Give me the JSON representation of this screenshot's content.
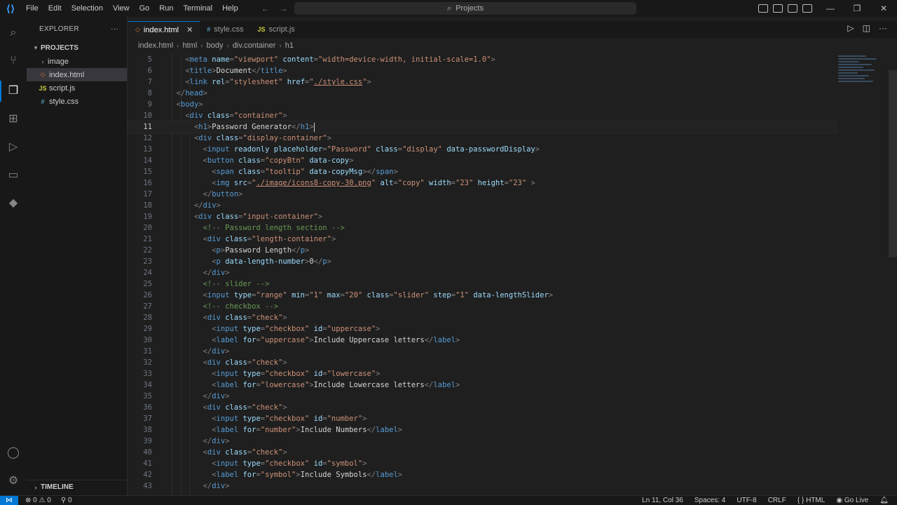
{
  "menu": [
    "File",
    "Edit",
    "Selection",
    "View",
    "Go",
    "Run",
    "Terminal",
    "Help"
  ],
  "command_center": {
    "icon": "search-icon",
    "label": "Projects"
  },
  "sidebar": {
    "title": "EXPLORER",
    "more": "···",
    "section": "PROJECTS",
    "items": [
      {
        "label": "image",
        "type": "folder"
      },
      {
        "label": "index.html",
        "type": "html",
        "selected": true
      },
      {
        "label": "script.js",
        "type": "js"
      },
      {
        "label": "style.css",
        "type": "css"
      }
    ],
    "timeline": "TIMELINE"
  },
  "tabs": [
    {
      "label": "index.html",
      "type": "html",
      "active": true
    },
    {
      "label": "style.css",
      "type": "css"
    },
    {
      "label": "script.js",
      "type": "js"
    }
  ],
  "breadcrumb": [
    "index.html",
    "html",
    "body",
    "div.container",
    "h1"
  ],
  "code_lines": [
    {
      "n": "5",
      "t": [
        [
          "    ",
          ""
        ],
        [
          "<",
          "p"
        ],
        [
          "meta",
          "g"
        ],
        [
          " name",
          "a"
        ],
        [
          "=",
          "p"
        ],
        [
          "\"viewport\"",
          "v"
        ],
        [
          " content",
          "a"
        ],
        [
          "=",
          "p"
        ],
        [
          "\"width=device-width, initial-scale=1.0\"",
          "v"
        ],
        [
          ">",
          "p"
        ]
      ]
    },
    {
      "n": "6",
      "t": [
        [
          "    ",
          ""
        ],
        [
          "<",
          "p"
        ],
        [
          "title",
          "g"
        ],
        [
          ">",
          "p"
        ],
        [
          "Document",
          "x"
        ],
        [
          "</",
          "p"
        ],
        [
          "title",
          "g"
        ],
        [
          ">",
          "p"
        ]
      ]
    },
    {
      "n": "7",
      "t": [
        [
          "    ",
          ""
        ],
        [
          "<",
          "p"
        ],
        [
          "link",
          "g"
        ],
        [
          " rel",
          "a"
        ],
        [
          "=",
          "p"
        ],
        [
          "\"stylesheet\"",
          "v"
        ],
        [
          " href",
          "a"
        ],
        [
          "=",
          "p"
        ],
        [
          "\"",
          "v"
        ],
        [
          "./style.css",
          "u"
        ],
        [
          "\"",
          "v"
        ],
        [
          ">",
          "p"
        ]
      ]
    },
    {
      "n": "8",
      "t": [
        [
          "  ",
          ""
        ],
        [
          "</",
          "p"
        ],
        [
          "head",
          "g"
        ],
        [
          ">",
          "p"
        ]
      ]
    },
    {
      "n": "9",
      "t": [
        [
          "  ",
          ""
        ],
        [
          "<",
          "p"
        ],
        [
          "body",
          "g"
        ],
        [
          ">",
          "p"
        ]
      ]
    },
    {
      "n": "10",
      "t": [
        [
          "    ",
          ""
        ],
        [
          "<",
          "p"
        ],
        [
          "div",
          "g"
        ],
        [
          " class",
          "a"
        ],
        [
          "=",
          "p"
        ],
        [
          "\"container\"",
          "v"
        ],
        [
          ">",
          "p"
        ]
      ]
    },
    {
      "n": "11",
      "t": [
        [
          "      ",
          ""
        ],
        [
          "<",
          "p"
        ],
        [
          "h1",
          "g"
        ],
        [
          ">",
          "p"
        ],
        [
          "Password Generator",
          "x"
        ],
        [
          "</",
          "p"
        ],
        [
          "h1",
          "g"
        ],
        [
          ">",
          "p"
        ]
      ],
      "current": true
    },
    {
      "n": "12",
      "t": [
        [
          "      ",
          ""
        ],
        [
          "<",
          "p"
        ],
        [
          "div",
          "g"
        ],
        [
          " class",
          "a"
        ],
        [
          "=",
          "p"
        ],
        [
          "\"display-container\"",
          "v"
        ],
        [
          ">",
          "p"
        ]
      ]
    },
    {
      "n": "13",
      "t": [
        [
          "        ",
          ""
        ],
        [
          "<",
          "p"
        ],
        [
          "input",
          "g"
        ],
        [
          " readonly placeholder",
          "a"
        ],
        [
          "=",
          "p"
        ],
        [
          "\"Password\"",
          "v"
        ],
        [
          " class",
          "a"
        ],
        [
          "=",
          "p"
        ],
        [
          "\"display\"",
          "v"
        ],
        [
          " data-passwordDisplay",
          "a"
        ],
        [
          ">",
          "p"
        ]
      ]
    },
    {
      "n": "14",
      "t": [
        [
          "        ",
          ""
        ],
        [
          "<",
          "p"
        ],
        [
          "button",
          "g"
        ],
        [
          " class",
          "a"
        ],
        [
          "=",
          "p"
        ],
        [
          "\"copyBtn\"",
          "v"
        ],
        [
          " data-copy",
          "a"
        ],
        [
          ">",
          "p"
        ]
      ]
    },
    {
      "n": "15",
      "t": [
        [
          "          ",
          ""
        ],
        [
          "<",
          "p"
        ],
        [
          "span",
          "g"
        ],
        [
          " class",
          "a"
        ],
        [
          "=",
          "p"
        ],
        [
          "\"tooltip\"",
          "v"
        ],
        [
          " data-copyMsg",
          "a"
        ],
        [
          ">",
          "p"
        ],
        [
          "</",
          "p"
        ],
        [
          "span",
          "g"
        ],
        [
          ">",
          "p"
        ]
      ]
    },
    {
      "n": "16",
      "t": [
        [
          "          ",
          ""
        ],
        [
          "<",
          "p"
        ],
        [
          "img",
          "g"
        ],
        [
          " src",
          "a"
        ],
        [
          "=",
          "p"
        ],
        [
          "\"",
          "v"
        ],
        [
          "./image/icons8-copy-30.png",
          "u"
        ],
        [
          "\"",
          "v"
        ],
        [
          " alt",
          "a"
        ],
        [
          "=",
          "p"
        ],
        [
          "\"copy\"",
          "v"
        ],
        [
          " width",
          "a"
        ],
        [
          "=",
          "p"
        ],
        [
          "\"23\"",
          "v"
        ],
        [
          " height",
          "a"
        ],
        [
          "=",
          "p"
        ],
        [
          "\"23\"",
          "v"
        ],
        [
          " >",
          "p"
        ]
      ]
    },
    {
      "n": "17",
      "t": [
        [
          "        ",
          ""
        ],
        [
          "</",
          "p"
        ],
        [
          "button",
          "g"
        ],
        [
          ">",
          "p"
        ]
      ]
    },
    {
      "n": "18",
      "t": [
        [
          "      ",
          ""
        ],
        [
          "</",
          "p"
        ],
        [
          "div",
          "g"
        ],
        [
          ">",
          "p"
        ]
      ]
    },
    {
      "n": "19",
      "t": [
        [
          "      ",
          ""
        ],
        [
          "<",
          "p"
        ],
        [
          "div",
          "g"
        ],
        [
          " class",
          "a"
        ],
        [
          "=",
          "p"
        ],
        [
          "\"input-container\"",
          "v"
        ],
        [
          ">",
          "p"
        ]
      ]
    },
    {
      "n": "20",
      "t": [
        [
          "        ",
          ""
        ],
        [
          "<!-- Password length section -->",
          "c"
        ]
      ]
    },
    {
      "n": "21",
      "t": [
        [
          "        ",
          ""
        ],
        [
          "<",
          "p"
        ],
        [
          "div",
          "g"
        ],
        [
          " class",
          "a"
        ],
        [
          "=",
          "p"
        ],
        [
          "\"length-container\"",
          "v"
        ],
        [
          ">",
          "p"
        ]
      ]
    },
    {
      "n": "22",
      "t": [
        [
          "          ",
          ""
        ],
        [
          "<",
          "p"
        ],
        [
          "p",
          "g"
        ],
        [
          ">",
          "p"
        ],
        [
          "Password Length",
          "x"
        ],
        [
          "</",
          "p"
        ],
        [
          "p",
          "g"
        ],
        [
          ">",
          "p"
        ]
      ]
    },
    {
      "n": "23",
      "t": [
        [
          "          ",
          ""
        ],
        [
          "<",
          "p"
        ],
        [
          "p",
          "g"
        ],
        [
          " data-length-number",
          "a"
        ],
        [
          ">",
          "p"
        ],
        [
          "0",
          "x"
        ],
        [
          "</",
          "p"
        ],
        [
          "p",
          "g"
        ],
        [
          ">",
          "p"
        ]
      ]
    },
    {
      "n": "24",
      "t": [
        [
          "        ",
          ""
        ],
        [
          "</",
          "p"
        ],
        [
          "div",
          "g"
        ],
        [
          ">",
          "p"
        ]
      ]
    },
    {
      "n": "25",
      "t": [
        [
          "        ",
          ""
        ],
        [
          "<!-- slider -->",
          "c"
        ]
      ]
    },
    {
      "n": "26",
      "t": [
        [
          "        ",
          ""
        ],
        [
          "<",
          "p"
        ],
        [
          "input",
          "g"
        ],
        [
          " type",
          "a"
        ],
        [
          "=",
          "p"
        ],
        [
          "\"range\"",
          "v"
        ],
        [
          " min",
          "a"
        ],
        [
          "=",
          "p"
        ],
        [
          "\"1\"",
          "v"
        ],
        [
          " max",
          "a"
        ],
        [
          "=",
          "p"
        ],
        [
          "\"20\"",
          "v"
        ],
        [
          " class",
          "a"
        ],
        [
          "=",
          "p"
        ],
        [
          "\"slider\"",
          "v"
        ],
        [
          " step",
          "a"
        ],
        [
          "=",
          "p"
        ],
        [
          "\"1\"",
          "v"
        ],
        [
          " data-lengthSlider",
          "a"
        ],
        [
          ">",
          "p"
        ]
      ]
    },
    {
      "n": "27",
      "t": [
        [
          "        ",
          ""
        ],
        [
          "<!-- checkbox -->",
          "c"
        ]
      ]
    },
    {
      "n": "28",
      "t": [
        [
          "        ",
          ""
        ],
        [
          "<",
          "p"
        ],
        [
          "div",
          "g"
        ],
        [
          " class",
          "a"
        ],
        [
          "=",
          "p"
        ],
        [
          "\"check\"",
          "v"
        ],
        [
          ">",
          "p"
        ]
      ]
    },
    {
      "n": "29",
      "t": [
        [
          "          ",
          ""
        ],
        [
          "<",
          "p"
        ],
        [
          "input",
          "g"
        ],
        [
          " type",
          "a"
        ],
        [
          "=",
          "p"
        ],
        [
          "\"checkbox\"",
          "v"
        ],
        [
          " id",
          "a"
        ],
        [
          "=",
          "p"
        ],
        [
          "\"uppercase\"",
          "v"
        ],
        [
          ">",
          "p"
        ]
      ]
    },
    {
      "n": "30",
      "t": [
        [
          "          ",
          ""
        ],
        [
          "<",
          "p"
        ],
        [
          "label",
          "g"
        ],
        [
          " for",
          "a"
        ],
        [
          "=",
          "p"
        ],
        [
          "\"uppercase\"",
          "v"
        ],
        [
          ">",
          "p"
        ],
        [
          "Include Uppercase letters",
          "x"
        ],
        [
          "</",
          "p"
        ],
        [
          "label",
          "g"
        ],
        [
          ">",
          "p"
        ]
      ]
    },
    {
      "n": "31",
      "t": [
        [
          "        ",
          ""
        ],
        [
          "</",
          "p"
        ],
        [
          "div",
          "g"
        ],
        [
          ">",
          "p"
        ]
      ]
    },
    {
      "n": "32",
      "t": [
        [
          "        ",
          ""
        ],
        [
          "<",
          "p"
        ],
        [
          "div",
          "g"
        ],
        [
          " class",
          "a"
        ],
        [
          "=",
          "p"
        ],
        [
          "\"check\"",
          "v"
        ],
        [
          ">",
          "p"
        ]
      ]
    },
    {
      "n": "33",
      "t": [
        [
          "          ",
          ""
        ],
        [
          "<",
          "p"
        ],
        [
          "input",
          "g"
        ],
        [
          " type",
          "a"
        ],
        [
          "=",
          "p"
        ],
        [
          "\"checkbox\"",
          "v"
        ],
        [
          " id",
          "a"
        ],
        [
          "=",
          "p"
        ],
        [
          "\"lowercase\"",
          "v"
        ],
        [
          ">",
          "p"
        ]
      ]
    },
    {
      "n": "34",
      "t": [
        [
          "          ",
          ""
        ],
        [
          "<",
          "p"
        ],
        [
          "label",
          "g"
        ],
        [
          " for",
          "a"
        ],
        [
          "=",
          "p"
        ],
        [
          "\"lowercase\"",
          "v"
        ],
        [
          ">",
          "p"
        ],
        [
          "Include Lowercase letters",
          "x"
        ],
        [
          "</",
          "p"
        ],
        [
          "label",
          "g"
        ],
        [
          ">",
          "p"
        ]
      ]
    },
    {
      "n": "35",
      "t": [
        [
          "        ",
          ""
        ],
        [
          "</",
          "p"
        ],
        [
          "div",
          "g"
        ],
        [
          ">",
          "p"
        ]
      ]
    },
    {
      "n": "36",
      "t": [
        [
          "        ",
          ""
        ],
        [
          "<",
          "p"
        ],
        [
          "div",
          "g"
        ],
        [
          " class",
          "a"
        ],
        [
          "=",
          "p"
        ],
        [
          "\"check\"",
          "v"
        ],
        [
          ">",
          "p"
        ]
      ]
    },
    {
      "n": "37",
      "t": [
        [
          "          ",
          ""
        ],
        [
          "<",
          "p"
        ],
        [
          "input",
          "g"
        ],
        [
          " type",
          "a"
        ],
        [
          "=",
          "p"
        ],
        [
          "\"checkbox\"",
          "v"
        ],
        [
          " id",
          "a"
        ],
        [
          "=",
          "p"
        ],
        [
          "\"number\"",
          "v"
        ],
        [
          ">",
          "p"
        ]
      ]
    },
    {
      "n": "38",
      "t": [
        [
          "          ",
          ""
        ],
        [
          "<",
          "p"
        ],
        [
          "label",
          "g"
        ],
        [
          " for",
          "a"
        ],
        [
          "=",
          "p"
        ],
        [
          "\"number\"",
          "v"
        ],
        [
          ">",
          "p"
        ],
        [
          "Include Numbers",
          "x"
        ],
        [
          "</",
          "p"
        ],
        [
          "label",
          "g"
        ],
        [
          ">",
          "p"
        ]
      ]
    },
    {
      "n": "39",
      "t": [
        [
          "        ",
          ""
        ],
        [
          "</",
          "p"
        ],
        [
          "div",
          "g"
        ],
        [
          ">",
          "p"
        ]
      ]
    },
    {
      "n": "40",
      "t": [
        [
          "        ",
          ""
        ],
        [
          "<",
          "p"
        ],
        [
          "div",
          "g"
        ],
        [
          " class",
          "a"
        ],
        [
          "=",
          "p"
        ],
        [
          "\"check\"",
          "v"
        ],
        [
          ">",
          "p"
        ]
      ]
    },
    {
      "n": "41",
      "t": [
        [
          "          ",
          ""
        ],
        [
          "<",
          "p"
        ],
        [
          "input",
          "g"
        ],
        [
          " type",
          "a"
        ],
        [
          "=",
          "p"
        ],
        [
          "\"checkbox\"",
          "v"
        ],
        [
          " id",
          "a"
        ],
        [
          "=",
          "p"
        ],
        [
          "\"symbol\"",
          "v"
        ],
        [
          ">",
          "p"
        ]
      ]
    },
    {
      "n": "42",
      "t": [
        [
          "          ",
          ""
        ],
        [
          "<",
          "p"
        ],
        [
          "label",
          "g"
        ],
        [
          " for",
          "a"
        ],
        [
          "=",
          "p"
        ],
        [
          "\"symbol\"",
          "v"
        ],
        [
          ">",
          "p"
        ],
        [
          "Include Symbols",
          "x"
        ],
        [
          "</",
          "p"
        ],
        [
          "label",
          "g"
        ],
        [
          ">",
          "p"
        ]
      ]
    },
    {
      "n": "43",
      "t": [
        [
          "        ",
          ""
        ],
        [
          "</",
          "p"
        ],
        [
          "div",
          "g"
        ],
        [
          ">",
          "p"
        ]
      ]
    }
  ],
  "status": {
    "errors": "0",
    "warnings": "0",
    "ports": "0",
    "position": "Ln 11, Col 36",
    "spaces": "Spaces: 4",
    "encoding": "UTF-8",
    "eol": "CRLF",
    "language": "HTML",
    "golive": "Go Live"
  },
  "colors": {
    "accent": "#0078d4",
    "tag": "#569cd6",
    "attr": "#9cdcfe",
    "string": "#ce9178",
    "comment": "#6a9955"
  }
}
